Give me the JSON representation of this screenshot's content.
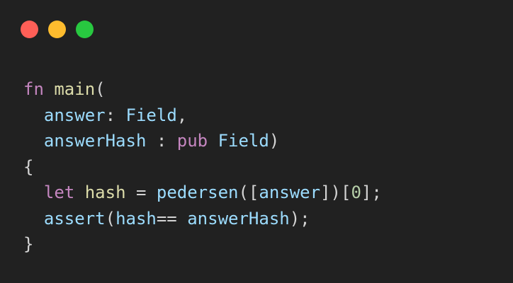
{
  "colors": {
    "background": "#212121",
    "close": "#ff5f57",
    "minimize": "#febc2e",
    "maximize": "#28c840",
    "keyword": "#c586c0",
    "function": "#dcdcaa",
    "identifier": "#9cdcfe",
    "number": "#b5cea8",
    "punctuation": "#d4d4d4"
  },
  "window_controls": [
    "close-icon",
    "minimize-icon",
    "maximize-icon"
  ],
  "code": {
    "line1": {
      "kw": "fn",
      "sp": " ",
      "name": "main",
      "punct": "("
    },
    "line2": {
      "indent": "  ",
      "param": "answer",
      "colon": ": ",
      "type": "Field",
      "comma": ","
    },
    "line3": {
      "indent": "  ",
      "param": "answerHash",
      "colon": " : ",
      "kw": "pub",
      "sp": " ",
      "type": "Field",
      "punct": ")"
    },
    "line4": {
      "punct": "{"
    },
    "line5": {
      "indent": "  ",
      "kw": "let",
      "sp1": " ",
      "var": "hash",
      "eq": " = ",
      "call": "pedersen",
      "open": "([",
      "arg": "answer",
      "close": "])[",
      "num": "0",
      "end": "];"
    },
    "line6": {
      "indent": "  ",
      "call": "assert",
      "open": "(",
      "a": "hash",
      "op": "== ",
      "b": "answerHash",
      "end": ");"
    },
    "line7": {
      "punct": "}"
    }
  }
}
